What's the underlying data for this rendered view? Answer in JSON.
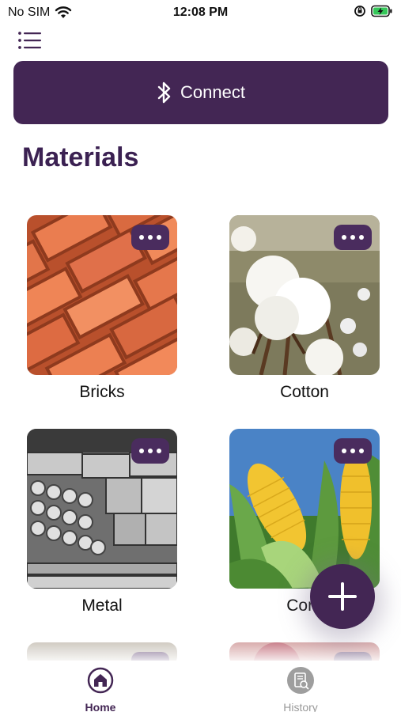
{
  "status_bar": {
    "carrier": "No SIM",
    "time": "12:08 PM",
    "icons": [
      "wifi-icon",
      "rotation-lock-icon",
      "battery-charging-icon"
    ]
  },
  "header": {
    "menu_icon": "list-icon"
  },
  "connect_button": {
    "icon": "bluetooth-icon",
    "label": "Connect"
  },
  "page": {
    "title": "Materials"
  },
  "materials": [
    {
      "label": "Bricks"
    },
    {
      "label": "Cotton"
    },
    {
      "label": "Metal"
    },
    {
      "label": "Corn"
    }
  ],
  "fab": {
    "icon": "plus-icon"
  },
  "tabs": [
    {
      "label": "Home",
      "icon": "home-icon",
      "active": true
    },
    {
      "label": "History",
      "icon": "history-icon",
      "active": false
    }
  ],
  "colors": {
    "primary": "#432654",
    "title": "#3b2152",
    "inactive": "#999999"
  }
}
